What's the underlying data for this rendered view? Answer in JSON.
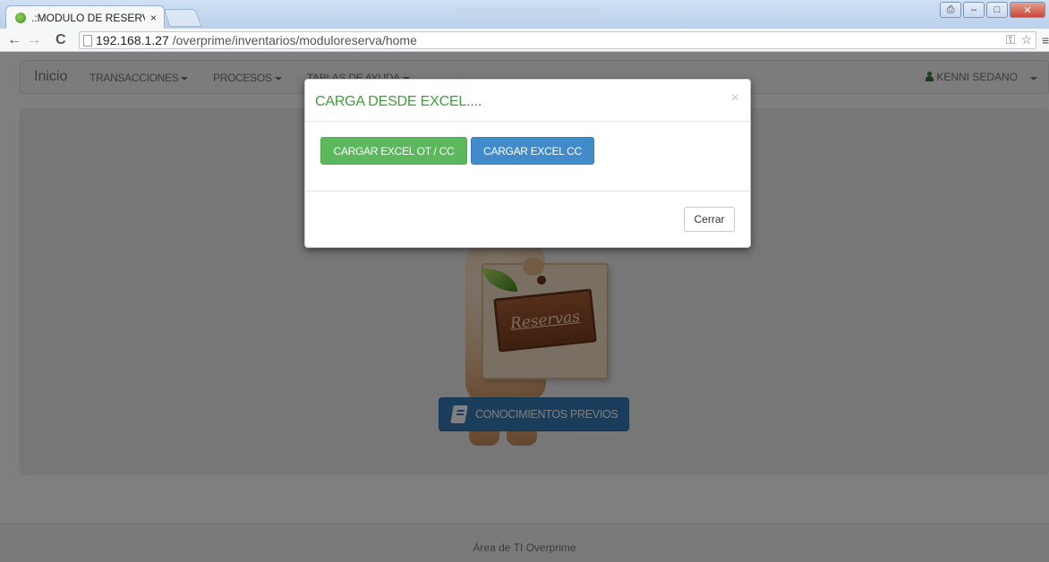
{
  "browser": {
    "tab_title": ".:MODULO DE RESERVA:.",
    "tab_close": "×",
    "url_host": "192.168.1.27",
    "url_path": "/overprime/inventarios/moduloreserva/home"
  },
  "navbar": {
    "brand": "Inicio",
    "menus": [
      "TRANSACCIONES",
      "PROCESOS",
      "TABLAS DE AYUDA"
    ],
    "user": "KENNI SEDANO"
  },
  "hero": {
    "sign_text": "Reservas",
    "button_label": "CONOCIMIENTOS PREVIOS"
  },
  "footer": {
    "text": "Área de TI Overprime"
  },
  "modal": {
    "title": "CARGA DESDE EXCEL....",
    "close": "×",
    "btn_excel_ot_cc": "CARGAR EXCEL OT / CC",
    "btn_excel_cc": "CARGAR EXCEL CC",
    "btn_cerrar": "Cerrar"
  },
  "colors": {
    "primary": "#337ab7",
    "success": "#5cb85c",
    "modal_title": "#3c9e3a"
  }
}
